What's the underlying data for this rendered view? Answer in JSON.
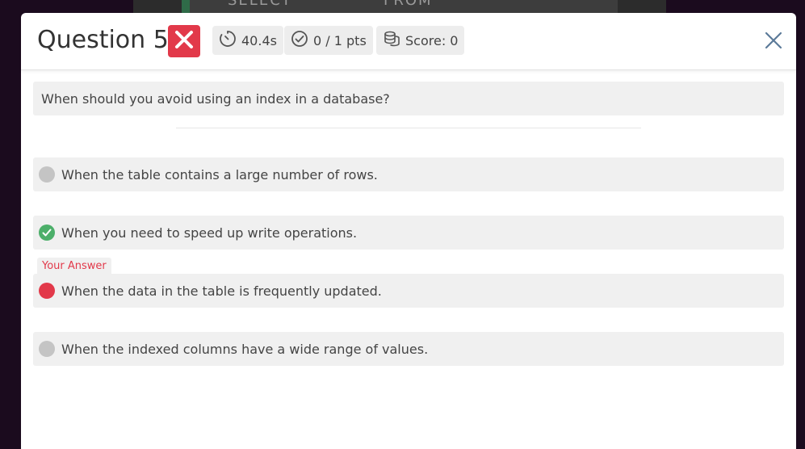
{
  "background": {
    "text_left": "SELECT",
    "text_right": "FROM"
  },
  "header": {
    "title": "Question 5",
    "result_icon": "x-mark-icon",
    "time": "40.4s",
    "points": "0 / 1 pts",
    "score": "Score: 0"
  },
  "question": {
    "text": "When should you avoid using an index in a database?"
  },
  "options": [
    {
      "text": "When the table contains a large number of rows.",
      "state": "neutral"
    },
    {
      "text": "When you need to speed up write operations.",
      "state": "correct"
    },
    {
      "text": "When the data in the table is frequently updated.",
      "state": "selected-wrong"
    },
    {
      "text": "When the indexed columns have a wide range of values.",
      "state": "neutral"
    }
  ],
  "your_answer_label": "Your Answer",
  "colors": {
    "wrong": "#e2394a",
    "correct": "#4caf6a",
    "neutral": "#c4c4c4"
  }
}
